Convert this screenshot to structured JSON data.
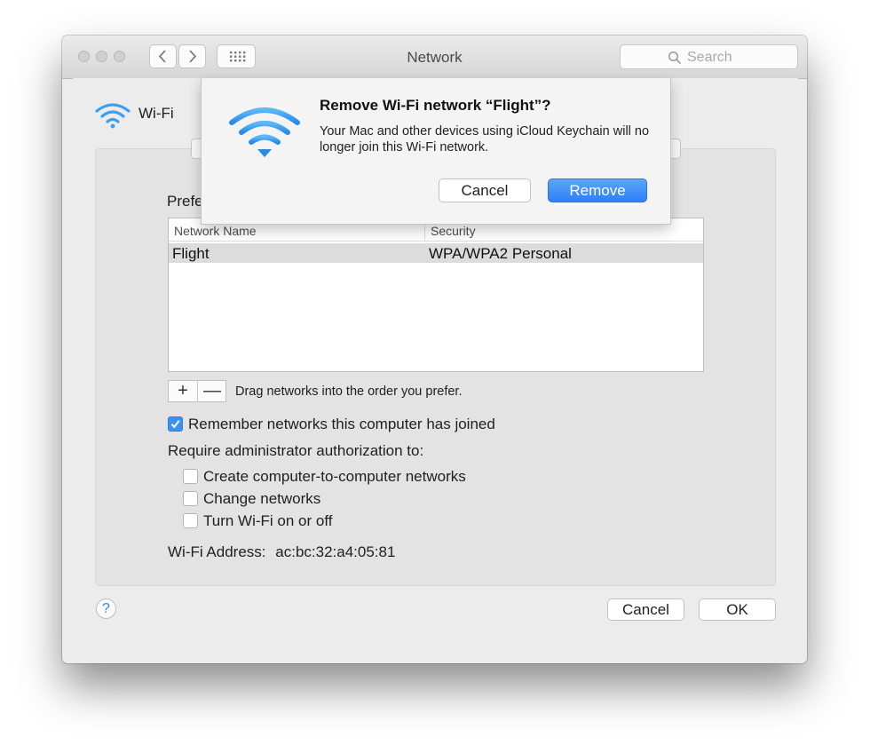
{
  "window": {
    "title": "Network",
    "search_placeholder": "Search"
  },
  "pane": {
    "interface_label": "Wi-Fi",
    "preferred_title": "Prefe",
    "table": {
      "columns": [
        "Network Name",
        "Security"
      ],
      "rows": [
        {
          "name": "Flight",
          "security": "WPA/WPA2 Personal",
          "selected": true
        }
      ]
    },
    "add_symbol": "+",
    "remove_symbol": "—",
    "drag_hint": "Drag networks into the order you prefer.",
    "remember_networks": {
      "label": "Remember networks this computer has joined",
      "checked": true
    },
    "require_admin_label": "Require administrator authorization to:",
    "admin_options": [
      {
        "label": "Create computer-to-computer networks",
        "checked": false
      },
      {
        "label": "Change networks",
        "checked": false
      },
      {
        "label": "Turn Wi-Fi on or off",
        "checked": false
      }
    ],
    "wifi_address_label": "Wi-Fi Address:",
    "wifi_address": "ac:bc:32:a4:05:81",
    "help_symbol": "?",
    "cancel_label": "Cancel",
    "ok_label": "OK"
  },
  "dialog": {
    "title": "Remove Wi-Fi network “Flight”?",
    "message": "Your Mac and other devices using iCloud Keychain will no longer join this Wi-Fi network.",
    "cancel_label": "Cancel",
    "remove_label": "Remove"
  },
  "colors": {
    "accent": "#3d8ef7",
    "wifi_icon": "#3a9ff0",
    "selection_row": "#dcdcdc"
  },
  "icons": [
    "close-light",
    "minimize-light",
    "zoom-light",
    "back-chevron-icon",
    "forward-chevron-icon",
    "grid-icon",
    "search-icon",
    "wifi-icon",
    "checkmark-icon"
  ]
}
